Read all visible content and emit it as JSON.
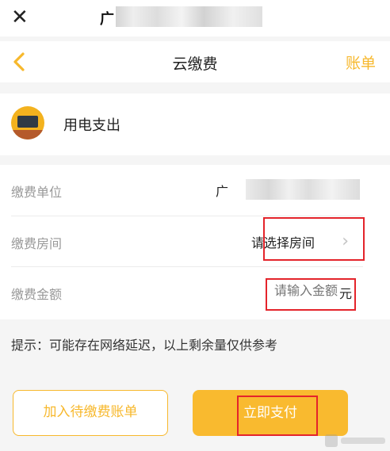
{
  "top": {
    "close_icon": "close-icon",
    "title_visible": "广"
  },
  "nav": {
    "title": "云缴费",
    "right_label": "账单",
    "back_icon": "chevron-left-icon",
    "accent": "#f7b82c"
  },
  "service": {
    "name": "用电支出",
    "icon": "tv-icon"
  },
  "form": {
    "unit_label": "缴费单位",
    "unit_value_visible": "广",
    "room_label": "缴费房间",
    "room_placeholder": "请选择房间",
    "amount_label": "缴费金额",
    "amount_placeholder": "请输入金额",
    "amount_unit": "元"
  },
  "tip": "提示：可能存在网络延迟，以上剩余量仅供参考",
  "buttons": {
    "add_to_bills": "加入待缴费账单",
    "pay_now": "立即支付"
  },
  "colors": {
    "accent": "#f7b82c",
    "highlight_box": "#e4242b"
  }
}
